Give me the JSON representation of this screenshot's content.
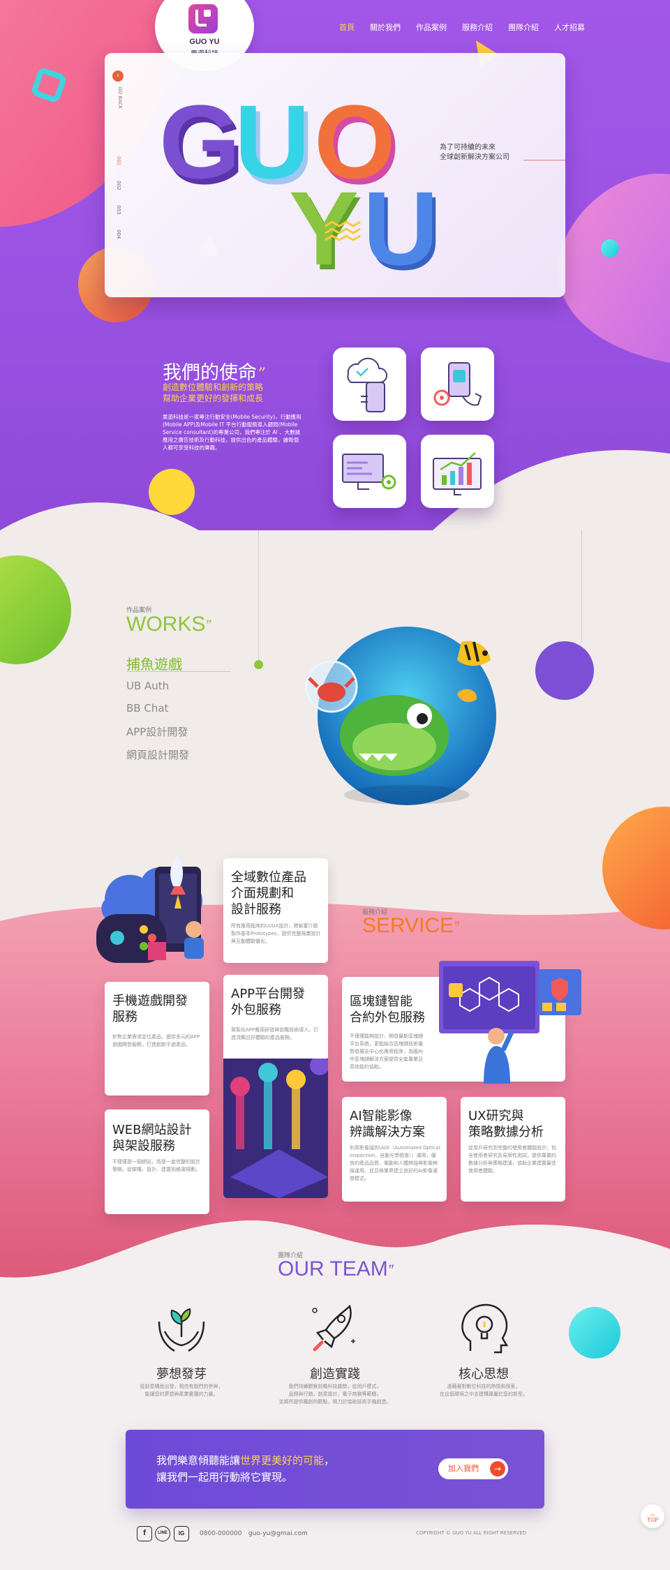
{
  "brand": {
    "name_en": "GUO YU",
    "name_zh": "果遊科技"
  },
  "nav": {
    "items": [
      {
        "label": "首頁"
      },
      {
        "label": "關於我們"
      },
      {
        "label": "作品案例"
      },
      {
        "label": "服務介紹"
      },
      {
        "label": "團隊介紹"
      },
      {
        "label": "人才招募"
      }
    ]
  },
  "hero": {
    "go_back": "GO BACK",
    "indices": [
      "001",
      "002",
      "003",
      "004"
    ],
    "word_line1": [
      "G",
      "U",
      "O"
    ],
    "word_line2": [
      "Y",
      "U"
    ],
    "tagline_1": "為了可持續的未來",
    "tagline_2": "全球創新解決方案公司"
  },
  "mission": {
    "title": "我們的使命",
    "sub_1": "創造數位體驗和創新的策略",
    "sub_2": "幫助企業更好的發揮和成長",
    "body": "果遊科技是一家專注行動安全(Mobile Security)，行動應用(Mobile APP)及Mobile IT 平台行動服務導入顧問(Mobile Service consultant)的專業公司，我們專注於 AI 、大數據應用之廣告技術及行動科技，提供出色的產品體驗，讓每個人都可享受科技的樂趣。",
    "icons": [
      "cloud-phone-icon",
      "phone-gear-icon",
      "desktop-gear-icon",
      "chart-monitor-icon"
    ]
  },
  "works": {
    "small": "作品案例",
    "title": "WORKS",
    "items": [
      {
        "label": "捕魚遊戲"
      },
      {
        "label": "UB Auth"
      },
      {
        "label": "BB Chat"
      },
      {
        "label": "APP設計開發"
      },
      {
        "label": "網頁設計開發"
      }
    ]
  },
  "service": {
    "small": "服務介紹",
    "title": "SERVICE",
    "cards": [
      {
        "title_1": "全域數位產品",
        "title_2": "介面規劃和",
        "title_3": "設計服務",
        "desc": "所有應用程序的UI/UX設計，跨裝置介面製作基本Prototypes，提供完整規畫設計與互動體驗優化。"
      },
      {
        "title_1": "手機遊戲開發",
        "title_2": "服務",
        "desc": "針對企業需求定位產品，提供多元的APP遊戲開發服務，打造創新手遊產品。"
      },
      {
        "title_1": "APP平台開發",
        "title_2": "外包服務",
        "desc": "客製化APP應用研發與前瞻技術導入，打造流暢且好體驗的產品服務。"
      },
      {
        "title_1": "區塊鏈智能",
        "title_2": "合約外包服務",
        "desc": "不僅僅能夠設計、開發最新區塊鏈平台系統，更能結合區塊鏈技術優勢發展去中心化應用程序，為國內外區塊鏈解決方案提供全套專業且高效能的協助。"
      },
      {
        "title_1": "WEB網站設計",
        "title_2": "與架設服務",
        "desc": "不僅僅是一個網站，而是一套完整的設計策略，從架構、設計、建置到維運規劃。"
      },
      {
        "title_1": "AI智能影像",
        "title_2": "辨識解決方案",
        "desc": "利用影像識別(AOI（Automated Optical Inspection，自動光學檢查））運用，優良的產品品質、電動和人體辨識與影像辨識運用，並且與業界建立良好的AI影像運營模式。"
      },
      {
        "title_1": "UX研究與",
        "title_2": "策略數據分析",
        "desc": "從用戶研究到完整的使用者體驗設計，包含使用者研究及易用性測試，提供專業的數據分析與策略建議，協助企業建置最佳使用者體驗。"
      }
    ]
  },
  "team": {
    "small": "團隊介紹",
    "title": "OUR TEAM",
    "members": [
      {
        "name": "夢想發芽",
        "desc_1": "從創意構思出發，相信有我們的參與，",
        "desc_2": "能讓您的夢想與產業實踐的力量。",
        "desc_3": "",
        "icon": "hands-sprout-icon"
      },
      {
        "name": "創造實踐",
        "desc_1": "我們持續觀察前瞻科技趨勢，從用戶模式，",
        "desc_2": "品牌與行銷、創意設計、電子商務等範疇，",
        "desc_3": "並將所提供獨創的觀點，努力於協助技術手機創造。",
        "icon": "rocket-icon"
      },
      {
        "name": "核心思想",
        "desc_1": "憑藉著對數位科技的熱情和探索，",
        "desc_2": "在這個環境之中去建構專屬於您的新型。",
        "desc_3": "",
        "icon": "head-idea-icon"
      }
    ]
  },
  "cta": {
    "line1_a": "我們樂意傾聽能讓",
    "line1_highlight": "世界更美好的可能",
    "line1_b": "，",
    "line2": "讓我們一起用行動將它實現。",
    "button": "加入我們",
    "arrow": "→"
  },
  "footer": {
    "social": [
      "f",
      "LINE",
      "IG"
    ],
    "phone": "0800-000000",
    "email": "guo-yu@gmai.com",
    "copyright": "COPYRIGHT © GUO YU ALL RIGHT RESERVED",
    "top": "TOP"
  },
  "colors": {
    "purple": "#9a52e3",
    "accent_yellow": "#ffd34d",
    "works_green": "#8dc63f",
    "service_orange": "#f47b20",
    "team_purple": "#7b53cf",
    "cta_red": "#f24a2e"
  }
}
